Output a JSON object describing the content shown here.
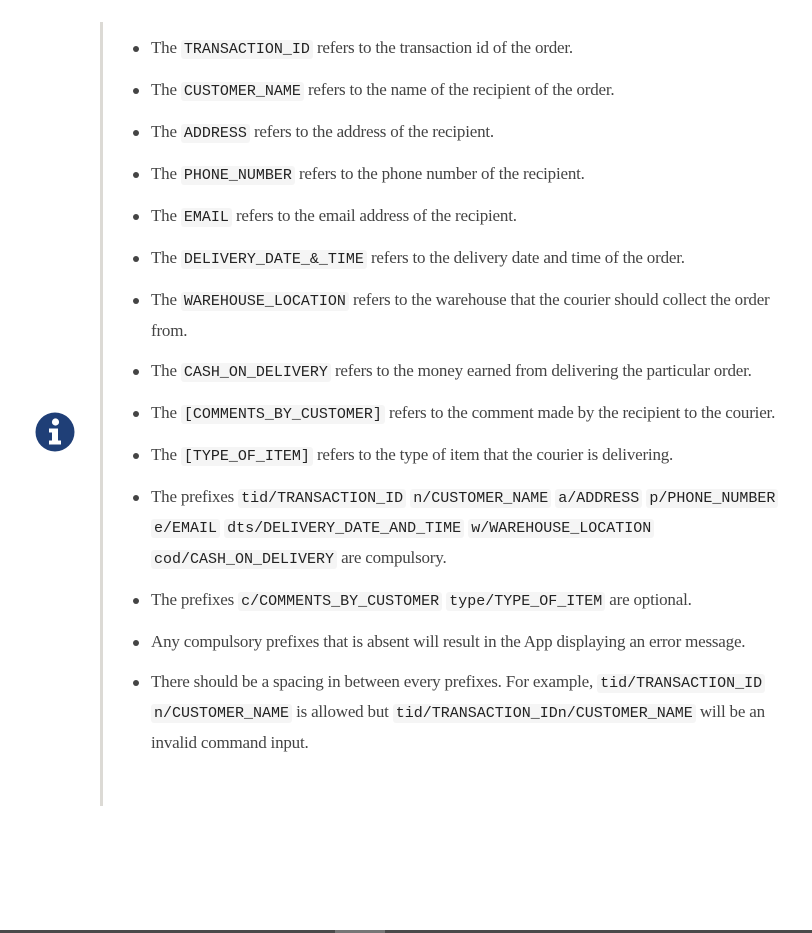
{
  "admonition": {
    "icon": "info-circle-icon",
    "icon_color": "#1f3f77",
    "items": [
      [
        {
          "t": "The "
        },
        {
          "c": "TRANSACTION_ID"
        },
        {
          "t": " refers to the transaction id of the order."
        }
      ],
      [
        {
          "t": "The "
        },
        {
          "c": "CUSTOMER_NAME"
        },
        {
          "t": " refers to the name of the recipient of the order."
        }
      ],
      [
        {
          "t": "The "
        },
        {
          "c": "ADDRESS"
        },
        {
          "t": " refers to the address of the recipient."
        }
      ],
      [
        {
          "t": "The "
        },
        {
          "c": "PHONE_NUMBER"
        },
        {
          "t": " refers to the phone number of the recipient."
        }
      ],
      [
        {
          "t": "The "
        },
        {
          "c": "EMAIL"
        },
        {
          "t": " refers to the email address of the recipient."
        }
      ],
      [
        {
          "t": "The "
        },
        {
          "c": "DELIVERY_DATE_&_TIME"
        },
        {
          "t": " refers to the delivery date and time of the order."
        }
      ],
      [
        {
          "t": "The "
        },
        {
          "c": "WAREHOUSE_LOCATION"
        },
        {
          "t": " refers to the warehouse that the courier should collect the order from."
        }
      ],
      [
        {
          "t": "The "
        },
        {
          "c": "CASH_ON_DELIVERY"
        },
        {
          "t": " refers to the money earned from delivering the particular order."
        }
      ],
      [
        {
          "t": "The "
        },
        {
          "c": "[COMMENTS_BY_CUSTOMER]"
        },
        {
          "t": " refers to the comment made by the recipient to the courier."
        }
      ],
      [
        {
          "t": "The "
        },
        {
          "c": "[TYPE_OF_ITEM]"
        },
        {
          "t": " refers to the type of item that the courier is delivering."
        }
      ],
      [
        {
          "t": "The prefixes "
        },
        {
          "c": "tid/TRANSACTION_ID"
        },
        {
          "t": " "
        },
        {
          "c": "n/CUSTOMER_NAME"
        },
        {
          "t": " "
        },
        {
          "c": "a/ADDRESS"
        },
        {
          "t": " "
        },
        {
          "c": "p/PHONE_NUMBER"
        },
        {
          "t": " "
        },
        {
          "c": "e/EMAIL"
        },
        {
          "t": " "
        },
        {
          "c": "dts/DELIVERY_DATE_AND_TIME"
        },
        {
          "t": " "
        },
        {
          "c": "w/WAREHOUSE_LOCATION"
        },
        {
          "t": " "
        },
        {
          "c": "cod/CASH_ON_DELIVERY"
        },
        {
          "t": " are compulsory."
        }
      ],
      [
        {
          "t": "The prefixes "
        },
        {
          "c": "c/COMMENTS_BY_CUSTOMER"
        },
        {
          "t": " "
        },
        {
          "c": "type/TYPE_OF_ITEM"
        },
        {
          "t": " are optional."
        }
      ],
      [
        {
          "t": "Any compulsory prefixes that is absent will result in the App displaying an error message."
        }
      ],
      [
        {
          "t": "There should be a spacing in between every prefixes. For example, "
        },
        {
          "c": "tid/TRANSACTION_ID"
        },
        {
          "t": " "
        },
        {
          "c": "n/CUSTOMER_NAME"
        },
        {
          "t": " is allowed but "
        },
        {
          "c": "tid/TRANSACTION_IDn/CUSTOMER_NAME"
        },
        {
          "t": " will be an invalid command input."
        }
      ]
    ]
  }
}
